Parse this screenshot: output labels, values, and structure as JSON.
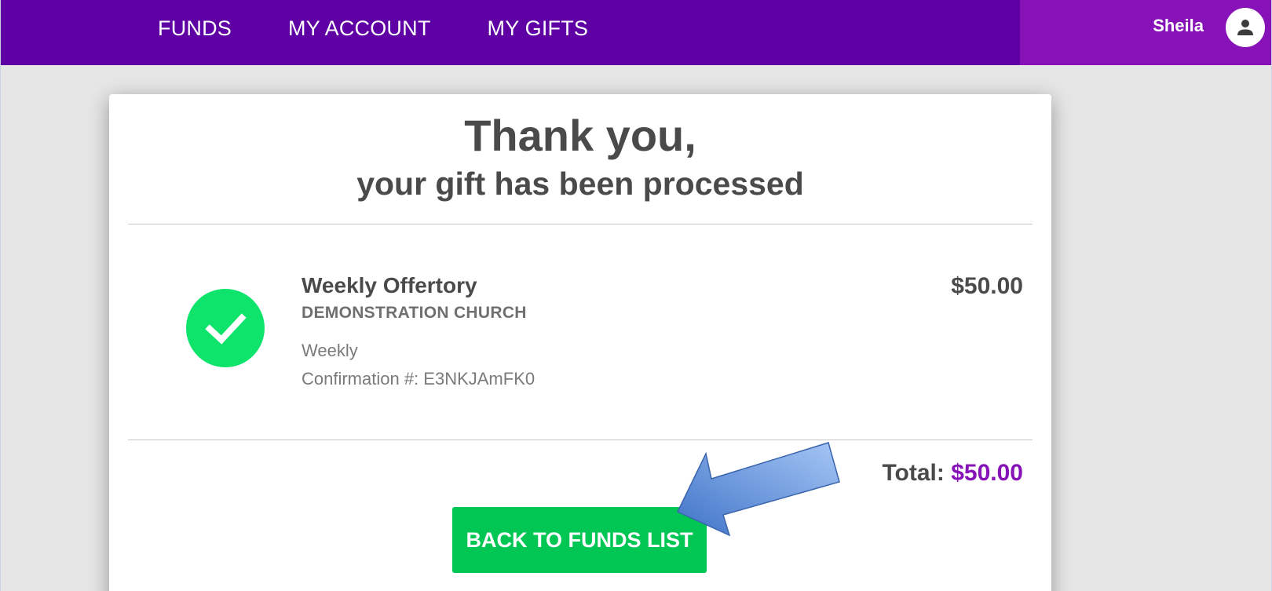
{
  "nav": {
    "items": [
      {
        "label": "FUNDS"
      },
      {
        "label": "MY ACCOUNT"
      },
      {
        "label": "MY GIFTS"
      }
    ]
  },
  "user": {
    "name": "Sheila",
    "avatar_icon": "person-icon"
  },
  "receipt": {
    "title": "Thank you,",
    "subtitle": "your gift has been processed",
    "gift": {
      "fund_name": "Weekly Offertory",
      "organization": "DEMONSTRATION CHURCH",
      "frequency": "Weekly",
      "confirmation": "Confirmation #: E3NKJAmFK0",
      "amount": "$50.00",
      "status_icon": "check-circle-icon"
    },
    "total": {
      "label": "Total:",
      "amount": "$50.00"
    },
    "back_button_label": "BACK TO FUNDS LIST"
  },
  "annotation": {
    "icon": "arrow-pointer-icon"
  },
  "colors": {
    "nav_bg": "#5e00a3",
    "user_area_bg": "#8612b8",
    "success_green": "#00c653",
    "check_green": "#0ee46b",
    "total_purple": "#8612b8",
    "arrow_blue": "#4a7fcf"
  }
}
